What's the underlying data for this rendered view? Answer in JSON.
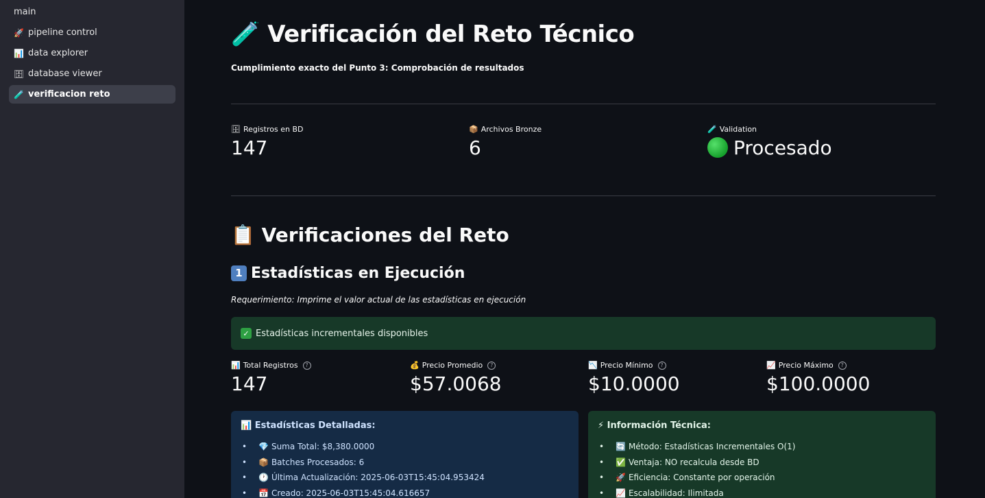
{
  "sidebar": {
    "items": [
      {
        "icon": "",
        "label": "main"
      },
      {
        "icon": "🚀",
        "label": "pipeline control"
      },
      {
        "icon": "📊",
        "label": "data explorer"
      },
      {
        "icon": "🗄",
        "label": "database viewer"
      },
      {
        "icon": "🧪",
        "label": "verificacion reto"
      }
    ],
    "active_index": 4
  },
  "header": {
    "title_icon": "🧪",
    "title": "Verificación del Reto Técnico",
    "subtitle": "Cumplimiento exacto del Punto 3: Comprobación de resultados"
  },
  "top_metrics": [
    {
      "icon": "🗄",
      "label": "Registros en BD",
      "value": "147"
    },
    {
      "icon": "📦",
      "label": "Archivos Bronze",
      "value": "6"
    },
    {
      "icon": "🧪",
      "label": "Validation",
      "value": "Procesado",
      "status_color": "#1fbf3a"
    }
  ],
  "section": {
    "icon": "📋",
    "title": "Verificaciones del Reto",
    "subsection_number": "1",
    "subsection_title": "Estadísticas en Ejecución",
    "requirement": "Requerimiento: Imprime el valor actual de las estadísticas en ejecución",
    "success_message": "Estadísticas incrementales disponibles"
  },
  "stats_metrics": [
    {
      "icon": "📊",
      "label": "Total Registros",
      "value": "147"
    },
    {
      "icon": "💰",
      "label": "Precio Promedio",
      "value": "$57.0068"
    },
    {
      "icon": "📉",
      "label": "Precio Mínimo",
      "value": "$10.0000"
    },
    {
      "icon": "📈",
      "label": "Precio Máximo",
      "value": "$100.0000"
    }
  ],
  "detailed_panel": {
    "icon": "📊",
    "title": "Estadísticas Detalladas:",
    "items": [
      {
        "icon": "💎",
        "text": "Suma Total: $8,380.0000"
      },
      {
        "icon": "📦",
        "text": "Batches Procesados: 6"
      },
      {
        "icon": "🕐",
        "text": "Última Actualización: 2025-06-03T15:45:04.953424"
      },
      {
        "icon": "📅",
        "text": "Creado: 2025-06-03T15:45:04.616657"
      }
    ]
  },
  "tech_panel": {
    "icon": "⚡",
    "title": "Información Técnica:",
    "items": [
      {
        "icon": "🔄",
        "text": "Método: Estadísticas Incrementales O(1)"
      },
      {
        "icon": "✅",
        "text": "Ventaja: NO recalcula desde BD"
      },
      {
        "icon": "🚀",
        "text": "Eficiencia: Constante por operación"
      },
      {
        "icon": "📈",
        "text": "Escalabilidad: Ilimitada"
      }
    ]
  },
  "colors": {
    "sidebar_bg": "#262730",
    "main_bg": "#0e1117",
    "success_bg": "#173928",
    "info_bg": "#152b45"
  }
}
